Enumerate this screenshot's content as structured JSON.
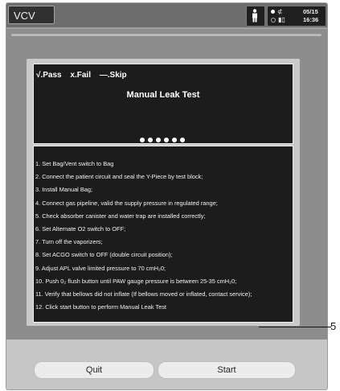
{
  "topbar": {
    "mode": "VCV",
    "date": "05/15",
    "time": "16:36",
    "icons": {
      "patient": "person-icon",
      "ac_power": "plug-icon",
      "battery": "battery-icon"
    }
  },
  "dialog": {
    "legend": {
      "pass": "√.Pass",
      "fail": "x.Fail",
      "skip": "—.Skip"
    },
    "title": "Manual Leak Test",
    "progress_dots_total": 6,
    "steps": [
      "1. Set Bag/Vent switch to Bag",
      "2. Connect the patient circuit and seal the Y-Piece by test block;",
      "3. Install Manual Bag;",
      "4. Connect gas pipeline, valid the supply pressure in regulated range;",
      "5. Check absorber canister and water trap are installed correctly;",
      "6. Set Alternate O2 switch to OFF;",
      "7. Turn off the vaporizers;",
      "8. Set ACGO switch to OFF (double circuit position);",
      "9. Adjust APL valve limited pressure to 70 cmH₂0;",
      "10. Push 0₂ flush button until PAW gauge pressure is between 25-35 cmH₂0;",
      "11. Verify that bellows did not inflate (If bellows moved or inflated, contact service);",
      "12. Click start button to perform Manual Leak Test"
    ]
  },
  "buttons": {
    "quit": "Quit",
    "start": "Start"
  },
  "callout": "5",
  "colors": {
    "screen_bg": "#8d8d8d",
    "panel_bg": "#1c1c1c",
    "button_bg": "#ececec"
  }
}
